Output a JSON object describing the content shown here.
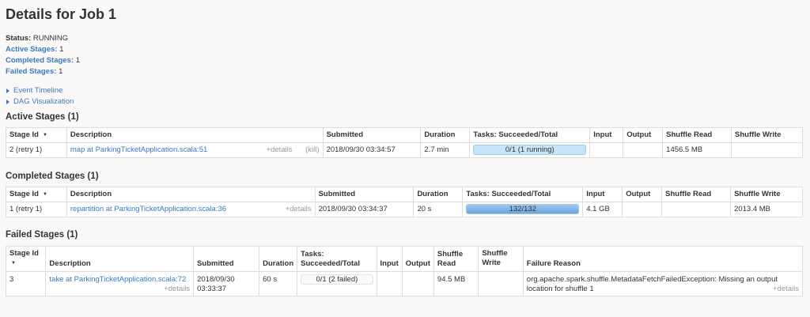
{
  "title": "Details for Job 1",
  "summary": {
    "status_label": "Status:",
    "status_value": "RUNNING",
    "active_label": "Active Stages:",
    "active_value": "1",
    "completed_label": "Completed Stages:",
    "completed_value": "1",
    "failed_label": "Failed Stages:",
    "failed_value": "1"
  },
  "toggles": {
    "event_timeline": "Event Timeline",
    "dag_visualization": "DAG Visualization"
  },
  "active": {
    "heading": "Active Stages (1)",
    "headers": {
      "stage_id": "Stage Id",
      "sort": "▼",
      "description": "Description",
      "submitted": "Submitted",
      "duration": "Duration",
      "tasks": "Tasks: Succeeded/Total",
      "input": "Input",
      "output": "Output",
      "shuffle_read": "Shuffle Read",
      "shuffle_write": "Shuffle Write"
    },
    "row": {
      "stage_id": "2 (retry 1)",
      "description": "map at ParkingTicketApplication.scala:51",
      "details": "+details",
      "kill": "(kill)",
      "submitted": "2018/09/30 03:34:57",
      "duration": "2.7 min",
      "tasks": "0/1 (1 running)",
      "tasks_fraction": 0,
      "input": "",
      "output": "",
      "shuffle_read": "1456.5 MB",
      "shuffle_write": ""
    }
  },
  "completed": {
    "heading": "Completed Stages (1)",
    "headers": {
      "stage_id": "Stage Id",
      "sort": "▼",
      "description": "Description",
      "submitted": "Submitted",
      "duration": "Duration",
      "tasks": "Tasks: Succeeded/Total",
      "input": "Input",
      "output": "Output",
      "shuffle_read": "Shuffle Read",
      "shuffle_write": "Shuffle Write"
    },
    "row": {
      "stage_id": "1 (retry 1)",
      "description": "repartition at ParkingTicketApplication.scala:36",
      "details": "+details",
      "submitted": "2018/09/30 03:34:37",
      "duration": "20 s",
      "tasks": "132/132",
      "tasks_fraction": 1,
      "input": "4.1 GB",
      "output": "",
      "shuffle_read": "",
      "shuffle_write": "2013.4 MB"
    }
  },
  "failed": {
    "heading": "Failed Stages (1)",
    "headers": {
      "stage_id": "Stage Id",
      "sort": "▼",
      "description": "Description",
      "submitted": "Submitted",
      "duration": "Duration",
      "tasks_line1": "Tasks:",
      "tasks_line2": "Succeeded/Total",
      "input": "Input",
      "output": "Output",
      "shuffle_read_line1": "Shuffle",
      "shuffle_read_line2": "Read",
      "shuffle_write_line1": "Shuffle",
      "shuffle_write_line2": "Write",
      "failure_reason": "Failure Reason"
    },
    "row": {
      "stage_id": "3",
      "description": "take at ParkingTicketApplication.scala:72",
      "details": "+details",
      "submitted_line1": "2018/09/30",
      "submitted_line2": "03:33:37",
      "duration": "60 s",
      "tasks": "0/1 (2 failed)",
      "tasks_fraction": 0,
      "input": "",
      "output": "",
      "shuffle_read": "94.5 MB",
      "shuffle_write": "",
      "failure_line1": "org.apache.spark.shuffle.MetadataFetchFailedException: Missing an output",
      "failure_line2": "location for shuffle 1",
      "failure_details": "+details"
    }
  }
}
